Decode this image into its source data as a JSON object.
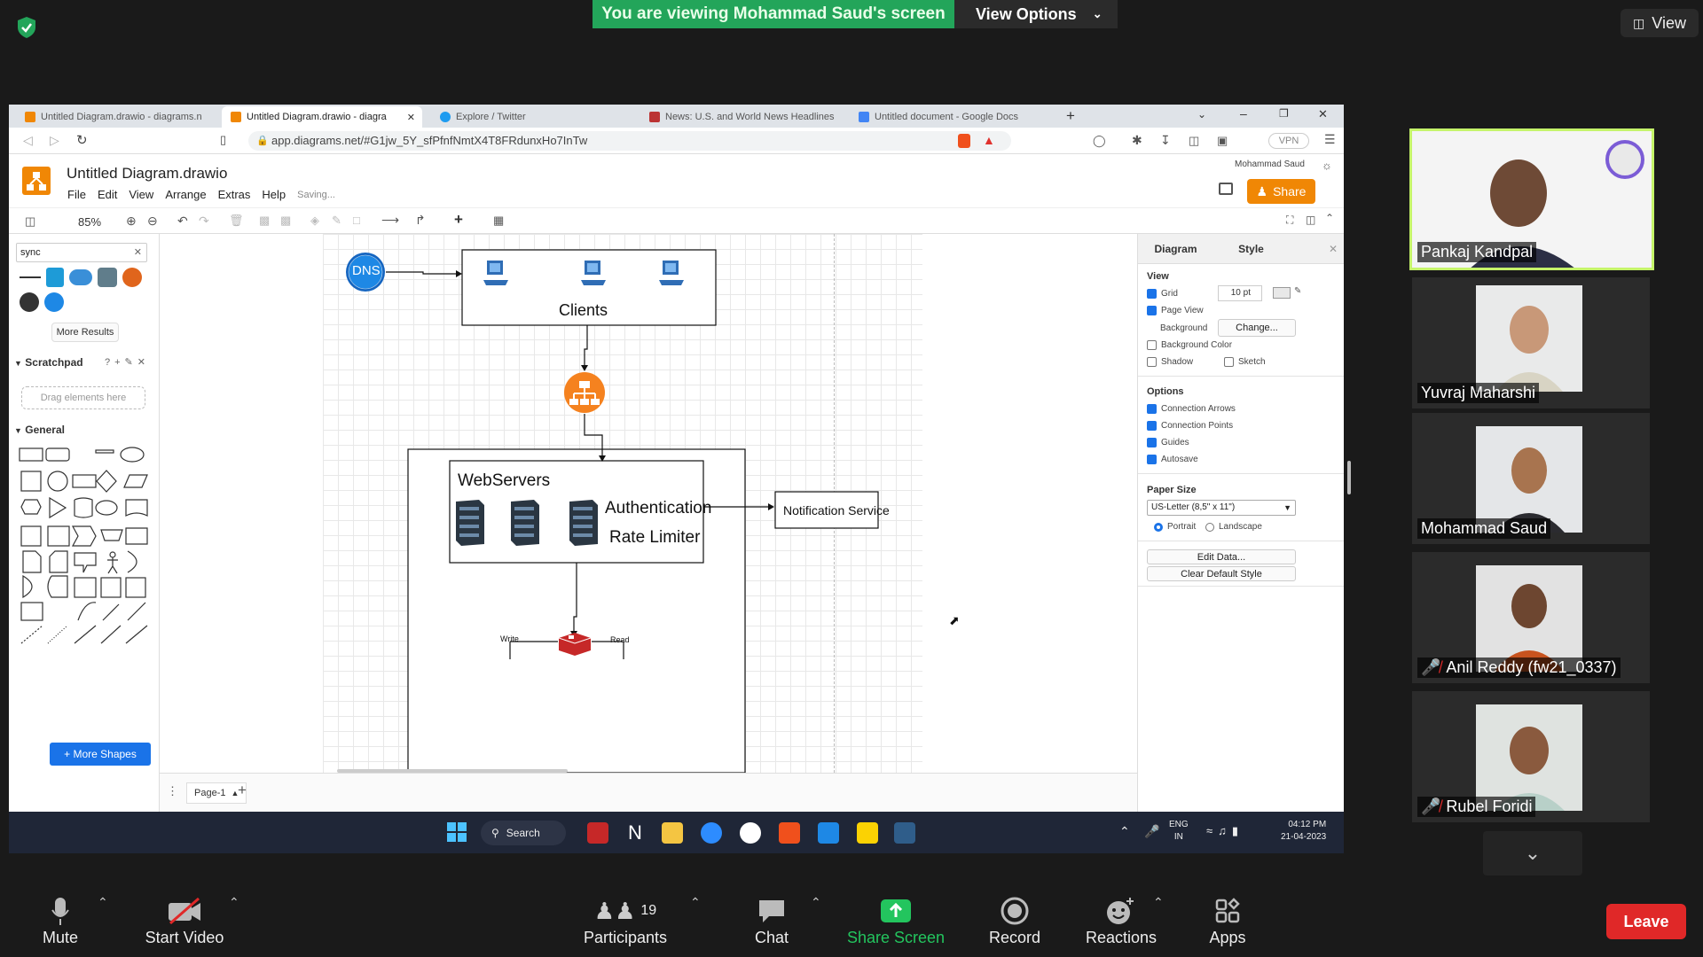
{
  "zoom": {
    "banner_text": "You are viewing Mohammad Saud's screen",
    "view_options_label": "View Options",
    "view_label": "View"
  },
  "browser": {
    "tabs": [
      {
        "title": "Untitled Diagram.drawio - diagrams.n",
        "active": false
      },
      {
        "title": "Untitled Diagram.drawio - diagra",
        "active": true
      },
      {
        "title": "Explore / Twitter",
        "active": false
      },
      {
        "title": "News: U.S. and World News Headlines",
        "active": false
      },
      {
        "title": "Untitled document - Google Docs",
        "active": false
      }
    ],
    "url": "app.diagrams.net/#G1jw_5Y_sfPfnfNmtX4T8FRdunxHo7InTw",
    "vpn_label": "VPN"
  },
  "drawio": {
    "title": "Untitled Diagram.drawio",
    "menus": [
      "File",
      "Edit",
      "View",
      "Arrange",
      "Extras",
      "Help"
    ],
    "saving_status": "Saving...",
    "user_name": "Mohammad Saud",
    "share_label": "Share",
    "zoom_level": "85%",
    "search_value": "sync",
    "more_results_label": "More Results",
    "scratchpad_label": "Scratchpad",
    "drag_hint": "Drag elements here",
    "general_label": "General",
    "more_shapes_label": "+ More Shapes",
    "page_tab_label": "Page-1",
    "diagram": {
      "dns_label": "DNS",
      "clients_label": "Clients",
      "webservers_label": "WebServers",
      "auth_label": "Authentication",
      "rate_label": "Rate Limiter",
      "notification_label": "Notification Service",
      "write_label": "Write",
      "read_label": "Read"
    },
    "right_panel": {
      "tab_diagram": "Diagram",
      "tab_style": "Style",
      "view_heading": "View",
      "grid_label": "Grid",
      "grid_size": "10 pt",
      "page_view_label": "Page View",
      "background_label": "Background",
      "change_label": "Change...",
      "background_color_label": "Background Color",
      "shadow_label": "Shadow",
      "sketch_label": "Sketch",
      "options_heading": "Options",
      "connection_arrows_label": "Connection Arrows",
      "connection_points_label": "Connection Points",
      "guides_label": "Guides",
      "autosave_label": "Autosave",
      "paper_size_heading": "Paper Size",
      "paper_size_value": "US-Letter (8,5\" x 11\")",
      "portrait_label": "Portrait",
      "landscape_label": "Landscape",
      "edit_data_label": "Edit Data...",
      "clear_style_label": "Clear Default Style"
    }
  },
  "taskbar": {
    "search_label": "Search",
    "lang_top": "ENG",
    "lang_bottom": "IN",
    "time": "04:12 PM",
    "date": "21-04-2023"
  },
  "participants": [
    {
      "name": "Pankaj Kandpal",
      "muted": false
    },
    {
      "name": "Yuvraj Maharshi",
      "muted": false
    },
    {
      "name": "Mohammad Saud",
      "muted": false
    },
    {
      "name": "Anil Reddy (fw21_0337)",
      "muted": true
    },
    {
      "name": "Rubel Foridi",
      "muted": true
    }
  ],
  "controls": {
    "mute": "Mute",
    "start_video": "Start Video",
    "participants": "Participants",
    "participants_count": "19",
    "chat": "Chat",
    "share_screen": "Share Screen",
    "record": "Record",
    "reactions": "Reactions",
    "apps": "Apps",
    "leave": "Leave"
  },
  "colors": {
    "banner_green": "#23a55a",
    "drawio_orange": "#f08705",
    "leave_red": "#e02828",
    "active_speaker": "#c5f46a"
  }
}
